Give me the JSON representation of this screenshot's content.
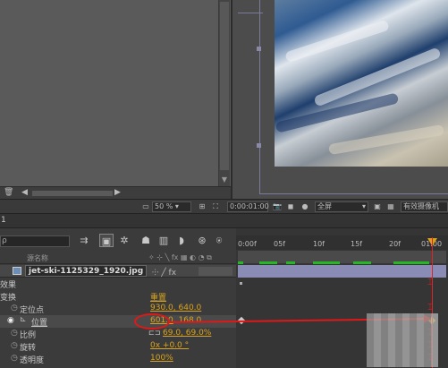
{
  "viewer_bar": {
    "zoom": "50 %",
    "timecode": "0:00:01:00",
    "resolution": "全屏",
    "camera": "有效摄像机"
  },
  "timeline": {
    "tab_label": "1",
    "search_glyph": "ρ",
    "column_header": "源名称",
    "ruler_ticks": [
      "0:00f",
      "05f",
      "10f",
      "15f",
      "20f",
      "01:00"
    ],
    "layer_name": "jet-ski-1125329_1920.jpg",
    "properties": [
      {
        "label": "效果",
        "value": ""
      },
      {
        "label": "变换",
        "value": "重置"
      },
      {
        "label": "定位点",
        "value": "930.0, 640.0"
      },
      {
        "label": "位置",
        "value_prefix": "601.0",
        "value_rest": ", 168.0"
      },
      {
        "label": "比例",
        "value": "69.0, 69.0%"
      },
      {
        "label": "旋转",
        "value": "0x +0.0 °"
      },
      {
        "label": "透明度",
        "value": "100%"
      }
    ]
  },
  "colors": {
    "keyframe": "#d9a320",
    "value_orange": "#d9a320",
    "annotation_red": "#e01818",
    "layer_bar": "#8a8cb6",
    "green_marker": "#24b824"
  }
}
